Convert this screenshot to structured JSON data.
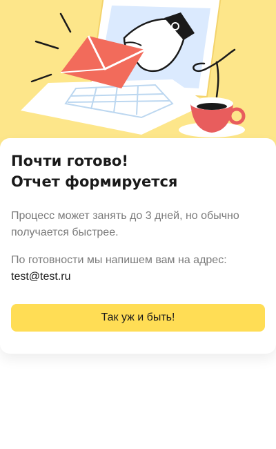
{
  "hero": {
    "illustration": "envelope-laptop-hand-coffee-illustration"
  },
  "card": {
    "title_line1": "Почти готово!",
    "title_line2": "Отчет формируется",
    "description": "Процесс может занять до 3 дней, но обычно получается быстрее.",
    "notice": "По готовности мы напишем вам на адрес:",
    "email": "test@test.ru",
    "button_label": "Так уж и быть!"
  },
  "colors": {
    "hero_bg": "#fde68a",
    "button_bg": "#ffdd55",
    "envelope": "#f26b5b",
    "cup": "#e85d5d",
    "screen": "#dbeafe"
  }
}
